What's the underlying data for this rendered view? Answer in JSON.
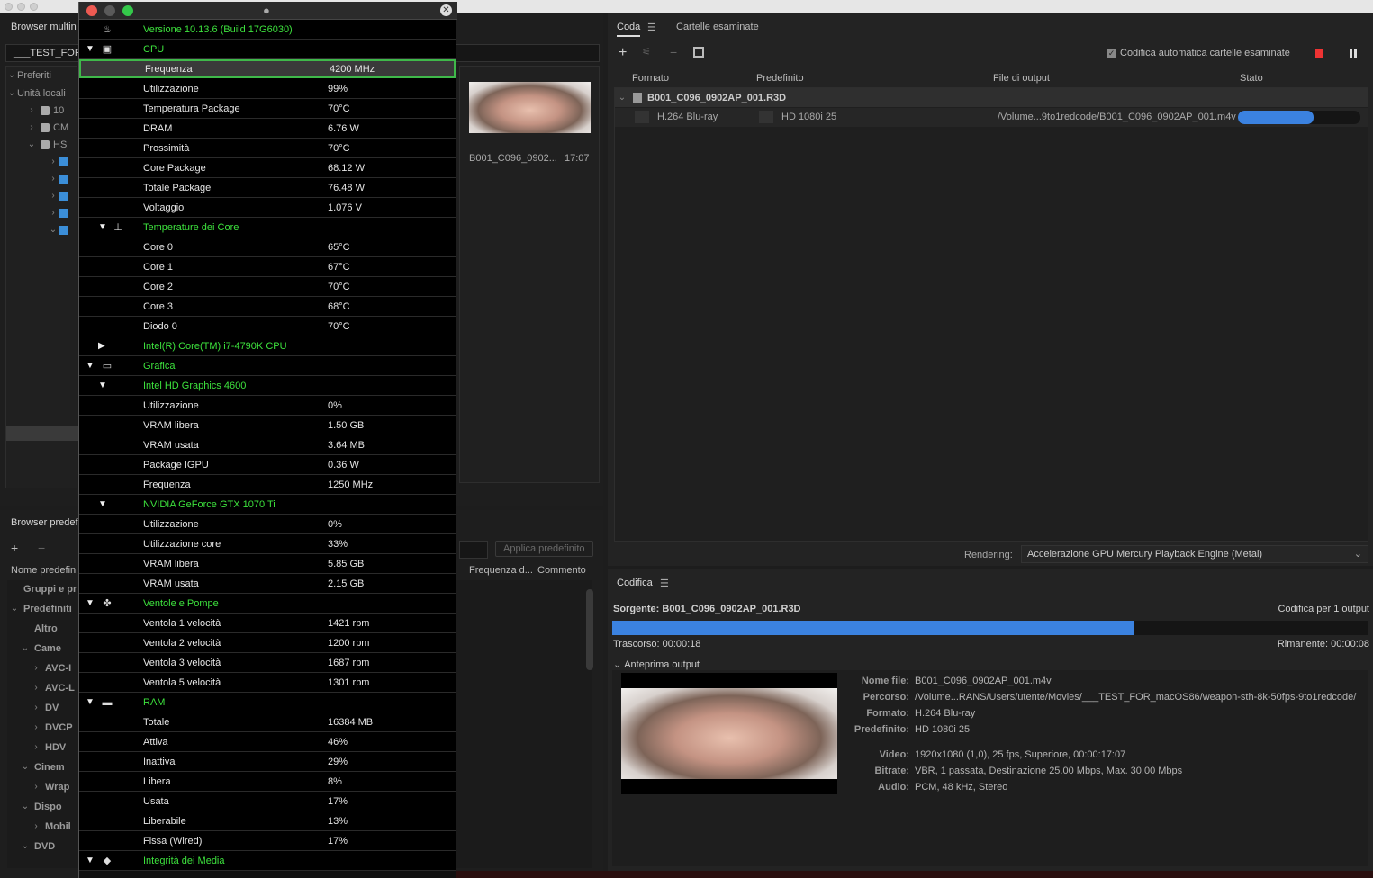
{
  "left_panel": {
    "media_browser_title": "Browser multin",
    "path_field": "___TEST_FOR_",
    "favorites": "Preferiti",
    "local_units": "Unità locali",
    "drives": [
      "10",
      "CM",
      "HS"
    ],
    "thumb_name": "B001_C096_0902...",
    "thumb_duration": "17:07"
  },
  "preset_panel": {
    "title": "Browser predef",
    "name_col": "Nome predefin",
    "freq_col": "Frequenza d...",
    "comment_col": "Commento",
    "apply_button": "Applica predefinito",
    "groups": "Gruppi e pr",
    "items": [
      "Predefiniti",
      "Altro",
      "Came",
      "AVC-I",
      "AVC-L",
      "DV",
      "DVCP",
      "HDV",
      "Cinem",
      "Wrap",
      "Dispo",
      "Mobil",
      "DVD"
    ]
  },
  "hw_monitor": {
    "rows": [
      {
        "type": "sec",
        "label": "Versione 10.13.6 (Build 17G6030)",
        "value": "",
        "indent": 0,
        "tri": "",
        "icon": "flame-icon"
      },
      {
        "type": "sec",
        "label": "CPU",
        "value": "",
        "indent": 0,
        "tri": "▼",
        "icon": "cpu-icon"
      },
      {
        "type": "item",
        "label": "Frequenza",
        "value": "4200 MHz",
        "sel": true
      },
      {
        "type": "item",
        "label": "Utilizzazione",
        "value": "99%"
      },
      {
        "type": "item",
        "label": "Temperatura Package",
        "value": "70°C"
      },
      {
        "type": "item",
        "label": "DRAM",
        "value": "6.76 W"
      },
      {
        "type": "item",
        "label": "Prossimità",
        "value": "70°C"
      },
      {
        "type": "item",
        "label": "Core Package",
        "value": "68.12 W"
      },
      {
        "type": "item",
        "label": "Totale Package",
        "value": "76.48 W"
      },
      {
        "type": "item",
        "label": "Voltaggio",
        "value": "1.076 V"
      },
      {
        "type": "sec",
        "label": "Temperature dei Core",
        "value": "",
        "indent": 1,
        "tri": "▼",
        "icon": "thermometer-icon"
      },
      {
        "type": "item",
        "label": "Core 0",
        "value": "65°C"
      },
      {
        "type": "item",
        "label": "Core 1",
        "value": "67°C"
      },
      {
        "type": "item",
        "label": "Core 2",
        "value": "70°C"
      },
      {
        "type": "item",
        "label": "Core 3",
        "value": "68°C"
      },
      {
        "type": "item",
        "label": "Diodo 0",
        "value": "70°C"
      },
      {
        "type": "sec",
        "label": "Intel(R) Core(TM) i7-4790K CPU",
        "value": "",
        "indent": 1,
        "tri": "▶",
        "icon": ""
      },
      {
        "type": "sec",
        "label": "Grafica",
        "value": "",
        "indent": 0,
        "tri": "▼",
        "icon": "gpu-icon"
      },
      {
        "type": "sec",
        "label": "Intel HD Graphics 4600",
        "value": "",
        "indent": 1,
        "tri": "▼",
        "icon": ""
      },
      {
        "type": "item",
        "label": "Utilizzazione",
        "value": "0%"
      },
      {
        "type": "item",
        "label": "VRAM libera",
        "value": "1.50 GB"
      },
      {
        "type": "item",
        "label": "VRAM usata",
        "value": "3.64 MB"
      },
      {
        "type": "item",
        "label": "Package IGPU",
        "value": "0.36 W"
      },
      {
        "type": "item",
        "label": "Frequenza",
        "value": "1250 MHz"
      },
      {
        "type": "sec",
        "label": "NVIDIA GeForce GTX 1070 Ti",
        "value": "",
        "indent": 1,
        "tri": "▼",
        "icon": ""
      },
      {
        "type": "item",
        "label": "Utilizzazione",
        "value": "0%"
      },
      {
        "type": "item",
        "label": "Utilizzazione core",
        "value": "33%"
      },
      {
        "type": "item",
        "label": "VRAM libera",
        "value": "5.85 GB"
      },
      {
        "type": "item",
        "label": "VRAM usata",
        "value": "2.15 GB"
      },
      {
        "type": "sec",
        "label": "Ventole e Pompe",
        "value": "",
        "indent": 0,
        "tri": "▼",
        "icon": "fan-icon"
      },
      {
        "type": "item",
        "label": "Ventola 1 velocità",
        "value": "1421 rpm"
      },
      {
        "type": "item",
        "label": "Ventola 2 velocità",
        "value": "1200 rpm"
      },
      {
        "type": "item",
        "label": "Ventola 3 velocità",
        "value": "1687 rpm"
      },
      {
        "type": "item",
        "label": "Ventola 5 velocità",
        "value": "1301 rpm"
      },
      {
        "type": "sec",
        "label": "RAM",
        "value": "",
        "indent": 0,
        "tri": "▼",
        "icon": "ram-icon"
      },
      {
        "type": "item",
        "label": "Totale",
        "value": "16384 MB"
      },
      {
        "type": "item",
        "label": "Attiva",
        "value": "46%"
      },
      {
        "type": "item",
        "label": "Inattiva",
        "value": "29%"
      },
      {
        "type": "item",
        "label": "Libera",
        "value": "8%"
      },
      {
        "type": "item",
        "label": "Usata",
        "value": "17%"
      },
      {
        "type": "item",
        "label": "Liberabile",
        "value": "13%"
      },
      {
        "type": "item",
        "label": "Fissa (Wired)",
        "value": "17%"
      },
      {
        "type": "sec",
        "label": "Integrità dei Media",
        "value": "",
        "indent": 0,
        "tri": "▼",
        "icon": "disk-icon"
      }
    ]
  },
  "queue": {
    "tab_queue": "Coda",
    "tab_watch": "Cartelle esaminate",
    "auto_encode": "Codifica automatica cartelle esaminate",
    "col_format": "Formato",
    "col_preset": "Predefinito",
    "col_output": "File di output",
    "col_status": "Stato",
    "source_file": "B001_C096_0902AP_001.R3D",
    "format": "H.264 Blu-ray",
    "preset": "HD 1080i 25",
    "output": "/Volume...9to1redcode/B001_C096_0902AP_001.m4v",
    "progress_fraction": 0.62,
    "rendering_label": "Rendering:",
    "rendering_value": "Accelerazione GPU Mercury Playback Engine (Metal)"
  },
  "encoding": {
    "title": "Codifica",
    "source": "Sorgente: B001_C096_0902AP_001.R3D",
    "outputs": "Codifica per 1 output",
    "progress_fraction": 0.69,
    "elapsed": "Trascorso: 00:00:18",
    "remaining": "Rimanente: 00:00:08",
    "preview_label": "Anteprima output",
    "details": [
      {
        "label": "Nome file:",
        "value": "B001_C096_0902AP_001.m4v"
      },
      {
        "label": "Percorso:",
        "value": "/Volume...RANS/Users/utente/Movies/___TEST_FOR_macOS86/weapon-sth-8k-50fps-9to1redcode/"
      },
      {
        "label": "Formato:",
        "value": "H.264 Blu-ray"
      },
      {
        "label": "Predefinito:",
        "value": "HD 1080i 25"
      },
      {
        "label": "Video:",
        "value": "1920x1080 (1,0), 25 fps, Superiore, 00:00:17:07"
      },
      {
        "label": "Bitrate:",
        "value": "VBR, 1 passata, Destinazione 25.00 Mbps, Max. 30.00 Mbps"
      },
      {
        "label": "Audio:",
        "value": "PCM, 48 kHz, Stereo"
      }
    ]
  }
}
